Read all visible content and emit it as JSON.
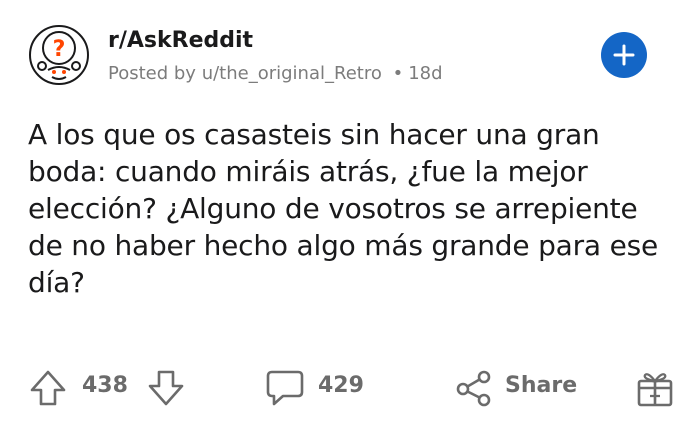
{
  "post": {
    "subreddit": "r/AskReddit",
    "posted_by_prefix": "Posted by",
    "author": "u/the_original_Retro",
    "separator": "•",
    "age": "18d",
    "title": "A los que os casasteis sin hacer una gran boda: cuando miráis atrás, ¿fue la mejor elección? ¿Alguno de vosotros se arrepiente de no haber hecho algo más grande para ese día?"
  },
  "actions": {
    "score": "438",
    "comments": "429",
    "share_label": "Share"
  },
  "icons": {
    "avatar": "askreddit-snoo-question-icon",
    "join": "plus-icon",
    "upvote": "arrow-up-icon",
    "downvote": "arrow-down-icon",
    "comment": "speech-bubble-icon",
    "share": "share-nodes-icon",
    "award": "gift-icon"
  },
  "colors": {
    "accent": "#1466c6",
    "avatar_question": "#ff4500",
    "muted": "#7c7c7c"
  }
}
